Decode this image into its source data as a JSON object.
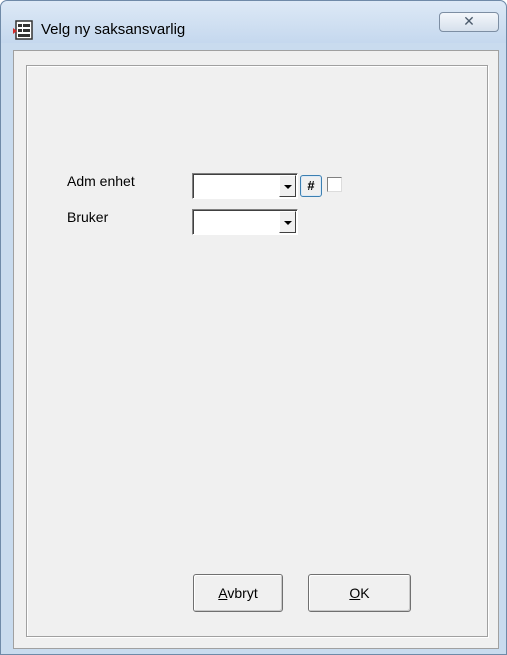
{
  "window": {
    "title": "Velg ny saksansvarlig",
    "icon": "form-app-icon",
    "close_label": "✕"
  },
  "form": {
    "adm_enhet": {
      "label": "Adm enhet",
      "value": "",
      "hash_button_label": "#",
      "checkbox_checked": false
    },
    "bruker": {
      "label": "Bruker",
      "value": ""
    }
  },
  "buttons": {
    "cancel": {
      "accel": "A",
      "rest": "vbryt"
    },
    "ok": {
      "accel": "O",
      "rest": "K"
    }
  }
}
